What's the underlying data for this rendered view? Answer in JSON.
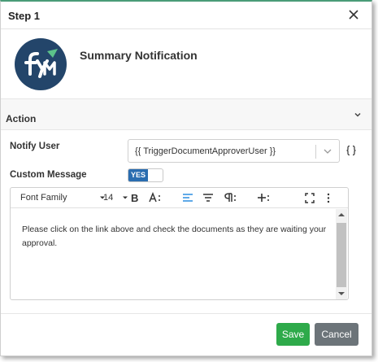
{
  "dialog": {
    "title": "Step 1",
    "close_icon": "close-icon"
  },
  "header": {
    "logo_icon": "fym-logo",
    "title": "Summary Notification"
  },
  "section": {
    "title": "Action",
    "chevron_icon": "chevron-down-icon"
  },
  "form": {
    "notify_user_label": "Notify User",
    "notify_user_value": "{{ TriggerDocumentApproverUser }}",
    "custom_message_label": "Custom Message",
    "custom_message_toggle": "YES"
  },
  "toolbar": {
    "font_family": "Font Family",
    "font_size": "14",
    "bold": "B"
  },
  "editor": {
    "content": "Please click on the link above and check the documents as they are waiting your approval."
  },
  "buttons": {
    "save": "Save",
    "cancel": "Cancel"
  },
  "colors": {
    "save": "#2eaa4a",
    "cancel": "#6c7479",
    "toggle_on": "#2a6db0",
    "logo_bg": "#23456a",
    "active_align": "#2a8ee0"
  }
}
